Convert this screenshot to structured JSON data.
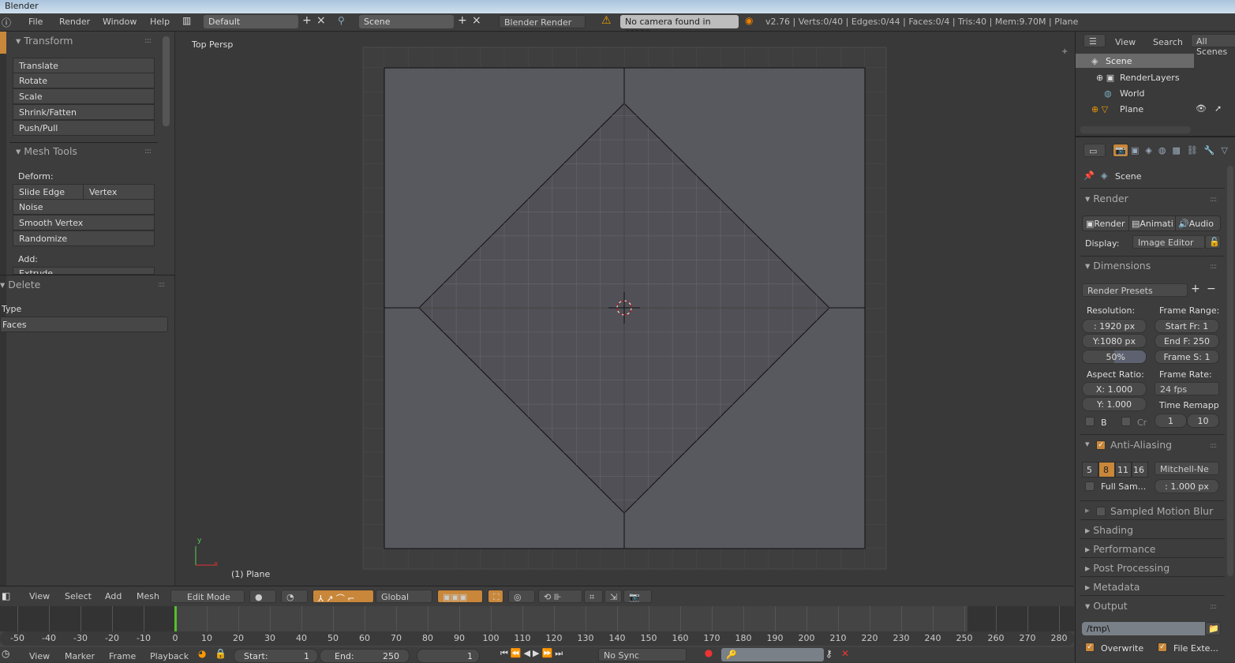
{
  "window": {
    "title": "Blender"
  },
  "info_header": {
    "menus": [
      "File",
      "Render",
      "Window",
      "Help"
    ],
    "layout": "Default",
    "scene": "Scene",
    "engine": "Blender Render",
    "warning": "No camera found in scene",
    "stats": "v2.76 | Verts:0/40 | Edges:0/44 | Faces:0/4 | Tris:40 | Mem:9.70M | Plane"
  },
  "tool_shelf": {
    "transform": {
      "title": "Transform",
      "buttons": [
        "Translate",
        "Rotate",
        "Scale",
        "Shrink/Fatten",
        "Push/Pull"
      ]
    },
    "mesh_tools": {
      "title": "Mesh Tools",
      "deform_label": "Deform:",
      "slide_edge": "Slide Edge",
      "vertex": "Vertex",
      "buttons": [
        "Noise",
        "Smooth Vertex",
        "Randomize"
      ],
      "add_label": "Add:",
      "extrude": "Extrude"
    },
    "operator": {
      "title": "Delete",
      "type_label": "Type",
      "type_value": "Faces"
    }
  },
  "viewport": {
    "view_name": "Top Persp",
    "object_label": "(1) Plane",
    "axis_y": "y",
    "axis_x": "x"
  },
  "view3d_header": {
    "menus": [
      "View",
      "Select",
      "Add",
      "Mesh"
    ],
    "mode": "Edit Mode",
    "orientation": "Global"
  },
  "timeline": {
    "ruler_labels": [
      "-50",
      "-40",
      "-30",
      "-20",
      "-10",
      "0",
      "10",
      "20",
      "30",
      "40",
      "50",
      "60",
      "70",
      "80",
      "90",
      "100",
      "110",
      "120",
      "130",
      "140",
      "150",
      "160",
      "170",
      "180",
      "190",
      "200",
      "210",
      "220",
      "230",
      "240",
      "250",
      "260",
      "270",
      "280"
    ],
    "current_frame_marker": 0,
    "accent": "#54c02c"
  },
  "timeline_header": {
    "menus": [
      "View",
      "Marker",
      "Frame",
      "Playback"
    ],
    "start_label": "Start:",
    "start": "1",
    "end_label": "End:",
    "end": "250",
    "current": "1",
    "sync": "No Sync"
  },
  "outliner": {
    "menus": [
      "View",
      "Search"
    ],
    "filter": "All Scenes",
    "items": [
      "Scene",
      "RenderLayers",
      "World",
      "Plane"
    ]
  },
  "properties": {
    "context": "Scene",
    "render": {
      "title": "Render",
      "buttons": [
        "Render",
        "Animati",
        "Audio"
      ],
      "display_label": "Display:",
      "display_value": "Image Editor"
    },
    "dimensions": {
      "title": "Dimensions",
      "presets": "Render Presets",
      "resolution_label": "Resolution:",
      "res_x": ": 1920 px",
      "res_y": "Y:1080 px",
      "res_pct": "50%",
      "frame_range_label": "Frame Range:",
      "start": "Start Fr:  1",
      "end": "End F: 250",
      "step": "Frame S: 1",
      "aspect_label": "Aspect Ratio:",
      "aspect_x": "X:    1.000",
      "aspect_y": "Y:    1.000",
      "frame_rate_label": "Frame Rate:",
      "fps": "24 fps",
      "time_remap_label": "Time Remapp",
      "border": "B",
      "crop": "Cr",
      "remap_old": "1",
      "remap_new": "10"
    },
    "anti_aliasing": {
      "title": "Anti-Aliasing",
      "enabled": true,
      "samples": [
        "5",
        "8",
        "11",
        "16"
      ],
      "selected": "8",
      "filter": "Mitchell-Ne",
      "full_sample": "Full Sam...",
      "size": ": 1.000 px"
    },
    "collapsed": [
      "Sampled Motion Blur",
      "Shading",
      "Performance",
      "Post Processing",
      "Metadata"
    ],
    "output": {
      "title": "Output",
      "path": "/tmp\\",
      "overwrite": "Overwrite",
      "file_ext": "File Exte..."
    }
  },
  "colors": {
    "accent": "#c8873a",
    "selected_row": "#6a6a6a"
  }
}
